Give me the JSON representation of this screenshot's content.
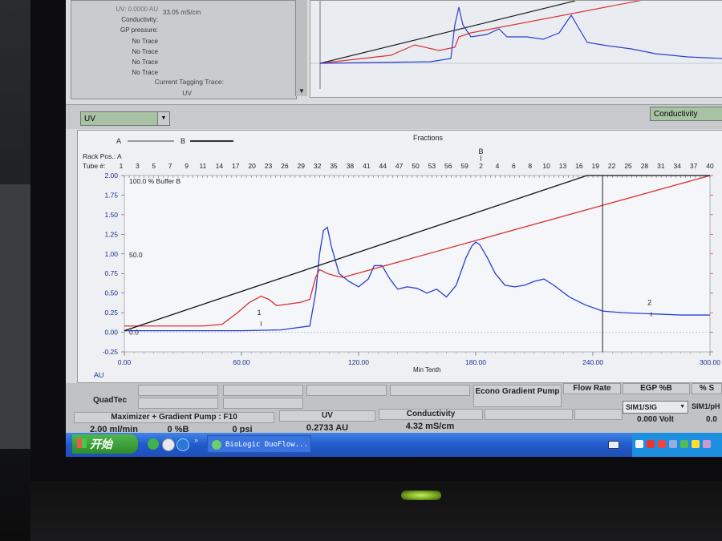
{
  "status": {
    "partial_top": "UV: 0.0000 AU",
    "conductivity_label": "Conductivity:",
    "conductivity_value": "33.05 mS/cm",
    "gp_label": "GP pressure:",
    "no_trace": [
      "No Trace",
      "No Trace",
      "No Trace",
      "No Trace"
    ],
    "current_tag_label": "Current Tagging Trace:",
    "current_tag_value": "UV"
  },
  "selectors": {
    "trace_left": "UV",
    "trace_right": "Conductivity"
  },
  "chart_header": {
    "legend_a": "A",
    "legend_b": "B",
    "fractions": "Fractions",
    "rack_pos": "Rack Pos.: A",
    "tube_label": "Tube #:",
    "rack_b_marker": "B",
    "tubes": [
      "1",
      "3",
      "5",
      "7",
      "9",
      "11",
      "14",
      "17",
      "20",
      "23",
      "26",
      "29",
      "32",
      "35",
      "38",
      "41",
      "44",
      "47",
      "50",
      "53",
      "56",
      "59",
      "2",
      "4",
      "6",
      "8",
      "10",
      "13",
      "16",
      "19",
      "22",
      "25",
      "28",
      "31",
      "34",
      "37",
      "40"
    ]
  },
  "chart_data": {
    "type": "line",
    "title": "",
    "xlabel": "Min Tenth",
    "ylabel": "AU",
    "xlim": [
      0,
      300
    ],
    "ylim": [
      -0.25,
      2.0
    ],
    "x_ticks": [
      "0.00",
      "60.00",
      "120.00",
      "180.00",
      "240.00",
      "300.00"
    ],
    "y_ticks": [
      "2.00",
      "1.75",
      "1.50",
      "1.25",
      "1.00",
      "0.75",
      "0.50",
      "0.25",
      "0.00",
      "-0.25"
    ],
    "annotations": [
      "100.0 % Buffer B",
      "50.0",
      "0.0",
      "1",
      "2"
    ],
    "cursor_x": 245,
    "series": [
      {
        "name": "UV",
        "color": "#2a3fd0",
        "x": [
          0,
          30,
          60,
          80,
          95,
          98,
          100,
          102,
          104,
          106,
          110,
          115,
          120,
          125,
          128,
          132,
          136,
          140,
          145,
          150,
          155,
          160,
          165,
          170,
          175,
          178,
          180,
          182,
          186,
          190,
          195,
          200,
          205,
          210,
          215,
          220,
          228,
          236,
          245,
          255,
          265,
          275,
          285,
          300
        ],
        "y": [
          0.02,
          0.02,
          0.02,
          0.03,
          0.08,
          0.5,
          1.0,
          1.3,
          1.34,
          1.1,
          0.75,
          0.65,
          0.58,
          0.68,
          0.85,
          0.85,
          0.68,
          0.55,
          0.58,
          0.56,
          0.5,
          0.55,
          0.45,
          0.6,
          0.95,
          1.1,
          1.15,
          1.12,
          0.95,
          0.75,
          0.6,
          0.58,
          0.6,
          0.65,
          0.68,
          0.6,
          0.45,
          0.35,
          0.27,
          0.25,
          0.24,
          0.23,
          0.22,
          0.22
        ]
      },
      {
        "name": "Conductivity",
        "color": "#d63030",
        "x": [
          0,
          40,
          50,
          58,
          64,
          70,
          74,
          78,
          84,
          90,
          95,
          98,
          100,
          104,
          108,
          112,
          300
        ],
        "y": [
          0.08,
          0.08,
          0.1,
          0.25,
          0.38,
          0.46,
          0.42,
          0.34,
          0.36,
          0.38,
          0.42,
          0.7,
          0.8,
          0.75,
          0.72,
          0.7,
          2.0
        ]
      },
      {
        "name": "% Buffer B",
        "color": "#111111",
        "x": [
          0,
          237,
          300
        ],
        "y": [
          0.02,
          2.0,
          2.0
        ]
      }
    ]
  },
  "bottom_panel": {
    "device": "QuadTec",
    "pump_label": "Maximizer + Gradient Pump : F10",
    "flow_value": "2.00 ml/min",
    "buffer_value": "0 %B",
    "pressure_value": "0 psi",
    "uv_label": "UV",
    "uv_value": "0.2733 AU",
    "cond_label": "Conductivity",
    "cond_value": "4.32 mS/cm",
    "econo_label": "Econo Gradient Pump",
    "flow_rate_label": "Flow Rate",
    "egp_label": "EGP %B",
    "partial_right": "% S",
    "sim_select": "SIM1/SIG",
    "sim_value": "0.000 Volt",
    "sim2_label": "SIM1/pH",
    "sim2_value": "0.0"
  },
  "taskbar": {
    "start_label": "开始",
    "task_label": "BioLogic DuoFlow..."
  }
}
